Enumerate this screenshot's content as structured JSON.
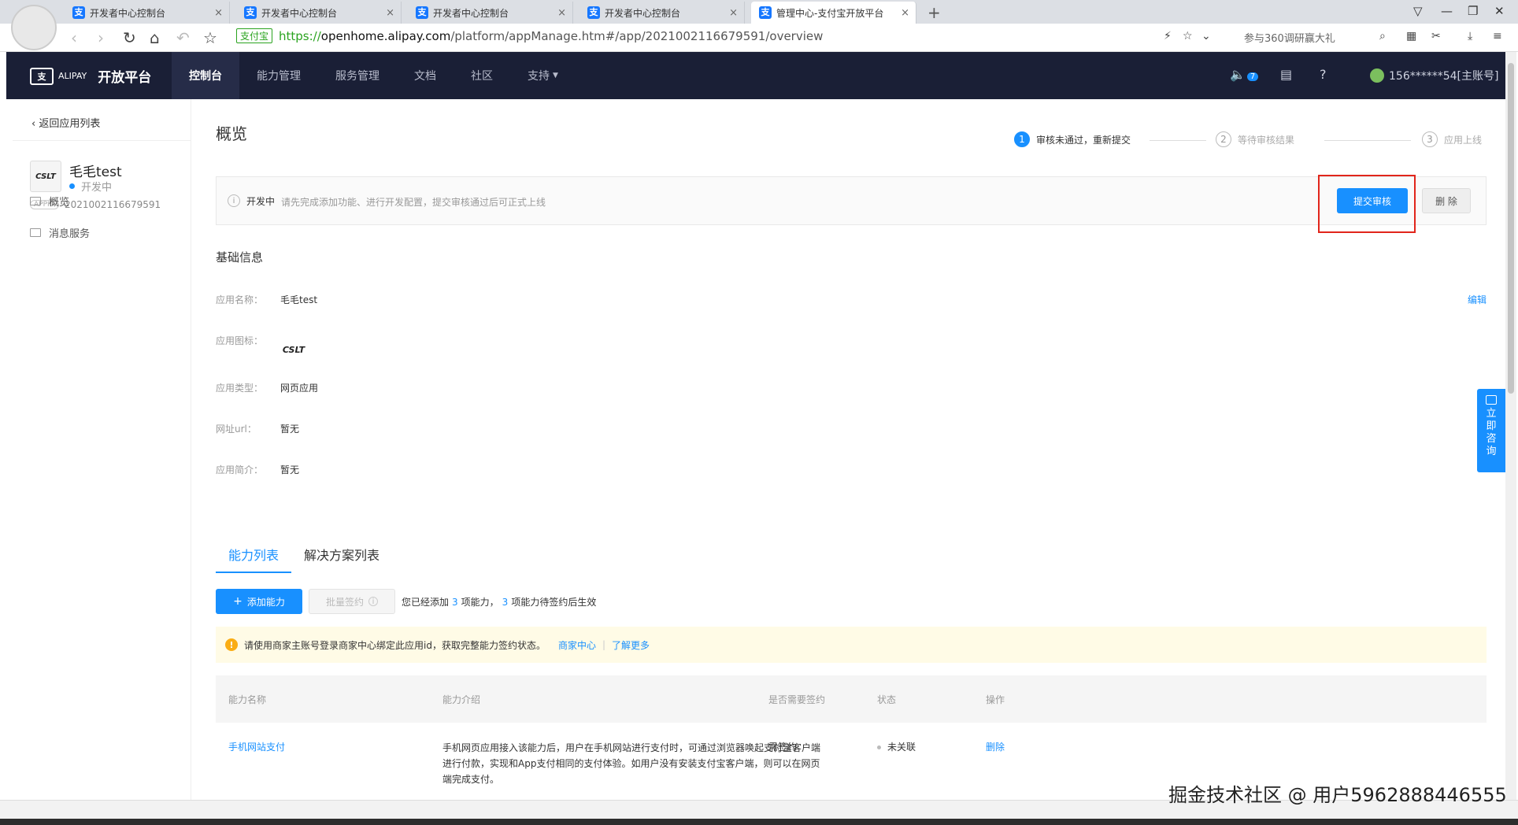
{
  "browser": {
    "tabs": [
      {
        "title": "开发者中心控制台",
        "active": false
      },
      {
        "title": "开发者中心控制台",
        "active": false
      },
      {
        "title": "开发者中心控制台",
        "active": false
      },
      {
        "title": "开发者中心控制台",
        "active": false
      },
      {
        "title": "管理中心-支付宝开放平台",
        "active": true
      }
    ],
    "secure_label": "支付宝",
    "url_scheme": "https://",
    "url_host": "openhome.alipay.com",
    "url_path": "/platform/appManage.htm#/app/2021002116679591/overview",
    "search_hint": "参与360调研赢大礼"
  },
  "header": {
    "logo_sub": "ALIPAY",
    "logo_title": "开放平台",
    "nav": [
      "控制台",
      "能力管理",
      "服务管理",
      "文档",
      "社区",
      "支持"
    ],
    "notif_count": "7",
    "user": "156******54[主账号]"
  },
  "sidebar": {
    "back": "返回应用列表",
    "app_name": "毛毛test",
    "app_status": "开发中",
    "appid_tag": "APPID",
    "appid": "2021002116679591",
    "icon_text": "CSLT",
    "items": [
      "概览",
      "消息服务"
    ]
  },
  "main": {
    "title": "概览",
    "steps": [
      {
        "num": "1",
        "label": "审核未通过，重新提交"
      },
      {
        "num": "2",
        "label": "等待审核结果"
      },
      {
        "num": "3",
        "label": "应用上线"
      }
    ],
    "status_label": "开发中",
    "status_desc": "请先完成添加功能、进行开发配置，提交审核通过后可正式上线",
    "submit_btn": "提交审核",
    "delete_btn": "删 除",
    "basic_title": "基础信息",
    "edit": "编辑",
    "fields": {
      "name_label": "应用名称：",
      "name_val": "毛毛test",
      "icon_label": "应用图标：",
      "type_label": "应用类型：",
      "type_val": "网页应用",
      "url_label": "网址url：",
      "url_val": "暂无",
      "desc_label": "应用简介：",
      "desc_val": "暂无"
    },
    "tabs": [
      "能力列表",
      "解决方案列表"
    ],
    "add_btn": "添加能力",
    "batch_btn": "批量签约",
    "added_text_1": "您已经添加",
    "added_count": "3",
    "added_text_2": "项能力，",
    "pending_count": "3",
    "added_text_3": "项能力待签约后生效",
    "warn_text": "请使用商家主账号登录商家中心绑定此应用id，获取完整能力签约状态。",
    "warn_link1": "商家中心",
    "warn_link2": "了解更多",
    "table_headers": [
      "能力名称",
      "能力介绍",
      "是否需要签约",
      "状态",
      "操作"
    ],
    "rows": [
      {
        "name": "手机网站支付",
        "desc": "手机网页应用接入该能力后，用户在手机网站进行支付时，可通过浏览器唤起支付宝客户端进行付款，实现和App支付相同的支付体验。如用户没有安装支付宝客户端，则可以在网页端完成支付。",
        "sign": "需签约",
        "status": "未关联",
        "action": "删除"
      }
    ]
  },
  "consult": [
    "立",
    "即",
    "咨",
    "询"
  ],
  "watermark": "掘金技术社区 @ 用户5962888446555",
  "colors": {
    "primary": "#1890ff",
    "header_bg": "#1a1f36",
    "highlight": "#e1251b",
    "warn_bg": "#fffbe6"
  }
}
